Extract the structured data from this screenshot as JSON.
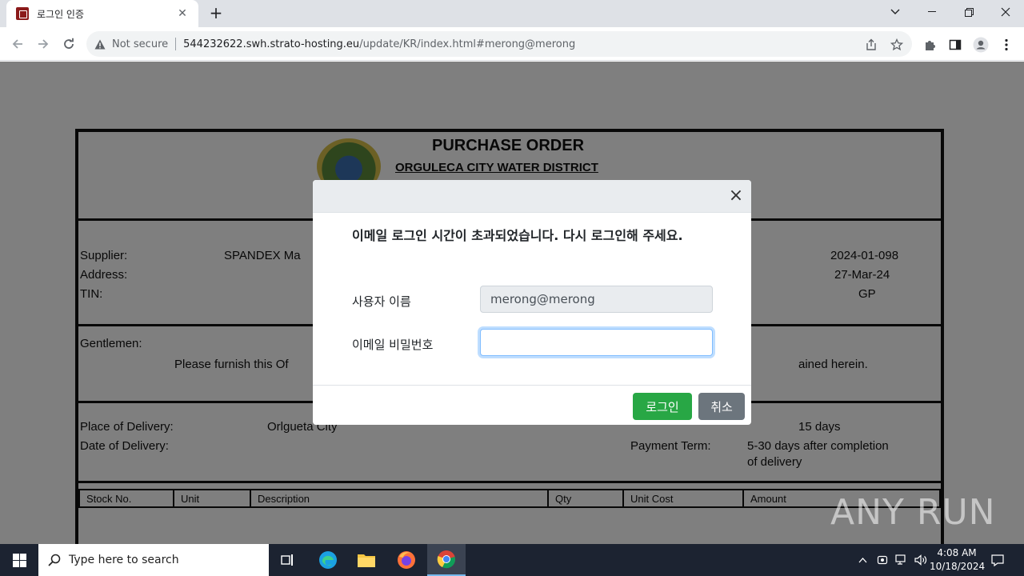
{
  "browser": {
    "tab_title": "로그인 인증",
    "new_tab_label": "+",
    "security_label": "Not secure",
    "url_host": "544232622.swh.strato-hosting.eu",
    "url_path": "/update/KR/index.html#merong@merong"
  },
  "document": {
    "title": "PURCHASE ORDER",
    "subtitle": "ORGULECA CITY WATER DISTRICT",
    "supplier_label": "Supplier:",
    "supplier_value": "SPANDEX Ma",
    "address_label": "Address:",
    "tin_label": "TIN:",
    "date_value": "2024-01-098",
    "date2_value": "27-Mar-24",
    "mode_value": "GP",
    "gentlemen_label": "Gentlemen:",
    "gentlemen_text": "Please furnish this Of",
    "gentlemen_text_end": "ained herein.",
    "delivery_place_label": "Place of Delivery:",
    "delivery_place_value": "Orlgueta City",
    "delivery_date_label": "Date of Delivery:",
    "payment_term_label": "Payment Term:",
    "delivery_term_value": "15 days",
    "payment_value": "5-30 days after completion",
    "payment_value2": "of delivery",
    "columns": [
      "Stock No.",
      "Unit",
      "Description",
      "Qty",
      "Unit Cost",
      "Amount"
    ]
  },
  "modal": {
    "close_label": "×",
    "message": "이메일 로그인 시간이 초과되었습니다. 다시 로그인해 주세요.",
    "username_label": "사용자 이름",
    "username_value": "merong@merong",
    "password_label": "이메일 비밀번호",
    "password_value": "",
    "login_button": "로그인",
    "cancel_button": "취소"
  },
  "watermark": "ANY RUN",
  "taskbar": {
    "search_placeholder": "Type here to search",
    "time": "4:08 AM",
    "date": "10/18/2024"
  }
}
